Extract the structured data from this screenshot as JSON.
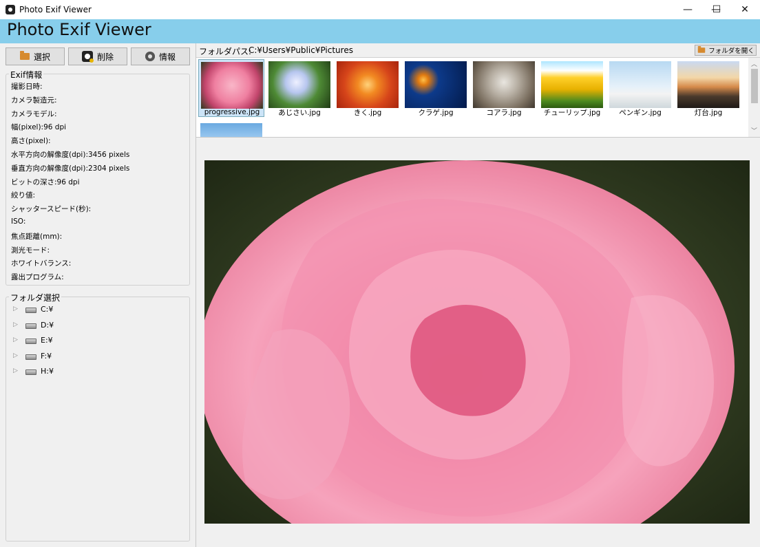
{
  "window": {
    "title": "Photo Exif Viewer",
    "minimize": "—",
    "maximize": "☐",
    "close": "✕"
  },
  "banner": {
    "title": "Photo Exif Viewer",
    "color": "#87ceeb"
  },
  "toolbar": {
    "select_label": "選択",
    "delete_label": "削除",
    "info_label": "情報"
  },
  "exif": {
    "title": "Exif情報",
    "rows": [
      "撮影日時:",
      "カメラ製造元:",
      "カメラモデル:",
      "幅(pixel):96 dpi",
      "高さ(pixel):",
      "水平方向の解像度(dpi):3456 pixels",
      "垂直方向の解像度(dpi):2304 pixels",
      "ビットの深さ:96 dpi",
      "絞り値:",
      "シャッタースピード(秒):",
      "ISO:",
      "焦点距離(mm):",
      "測光モード:",
      "ホワイトバランス:",
      "露出プログラム:"
    ]
  },
  "folder_tree": {
    "title": "フォルダ選択",
    "drives": [
      "C:¥",
      "D:¥",
      "E:¥",
      "F:¥",
      "H:¥"
    ]
  },
  "path": {
    "label": "フォルダパス:",
    "value": "C:¥Users¥Public¥Pictures",
    "open_button": "フォルダを開く"
  },
  "thumbnails": [
    {
      "name": "progressive.jpg",
      "selected": true
    },
    {
      "name": "あじさい.jpg"
    },
    {
      "name": "きく.jpg"
    },
    {
      "name": "クラゲ.jpg"
    },
    {
      "name": "コアラ.jpg"
    },
    {
      "name": "チューリップ.jpg"
    },
    {
      "name": "ペンギン.jpg"
    },
    {
      "name": "灯台.jpg"
    }
  ]
}
